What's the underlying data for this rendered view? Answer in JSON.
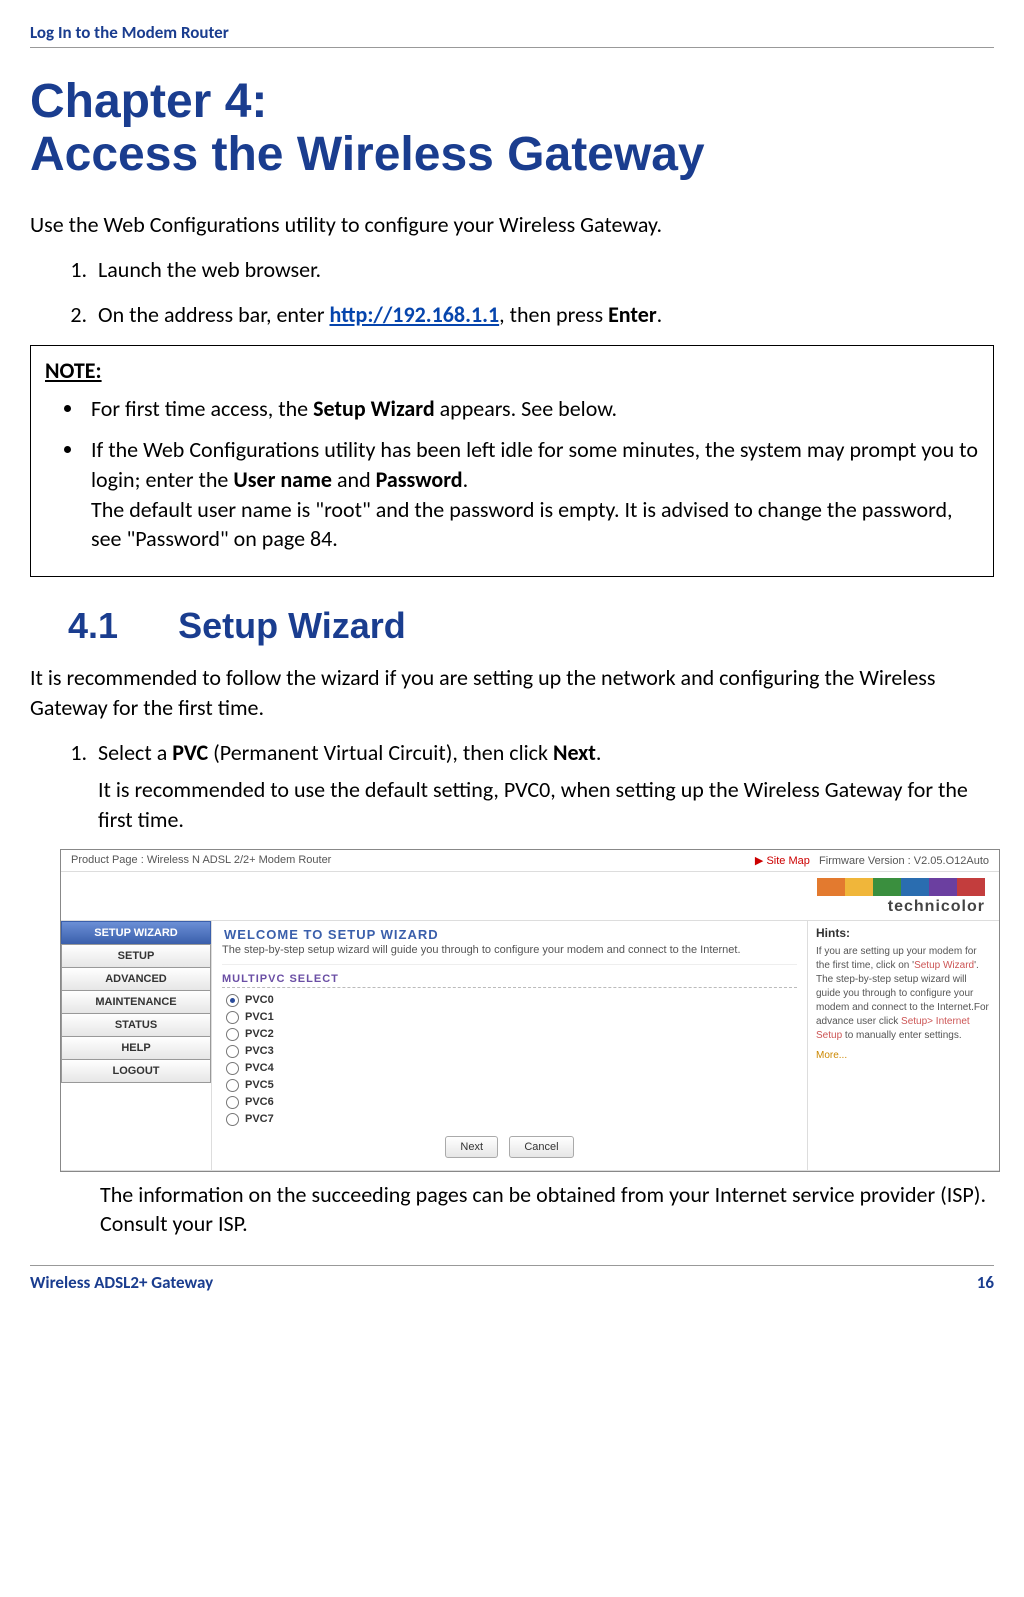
{
  "header": {
    "title": "Log In to the Modem Router"
  },
  "chapter": {
    "line1": "Chapter 4:",
    "line2": "Access the Wireless Gateway"
  },
  "intro": "Use the Web Configurations utility to configure your Wireless Gateway.",
  "steps_top": {
    "s1": "Launch the web browser.",
    "s2_a": "On the address bar, enter ",
    "s2_link": "http://192.168.1.1",
    "s2_b": ", then press ",
    "s2_bold": "Enter",
    "s2_c": "."
  },
  "note": {
    "label": "NOTE:",
    "b1_a": "For first time access, the ",
    "b1_bold": "Setup Wizard",
    "b1_b": " appears. See below.",
    "b2_a": "If the Web Configurations utility has been left idle for some minutes, the system may prompt you to login; enter the ",
    "b2_bold1": "User name",
    "b2_mid": " and ",
    "b2_bold2": "Password",
    "b2_b": ".",
    "b2_c": "The default user name is \"root\" and the password is empty. It is advised to change the password, see \"Password\" on page 84."
  },
  "section": {
    "num": "4.1",
    "title": "Setup Wizard"
  },
  "section_intro": "It is recommended to follow the wizard if you are setting up the network and configuring the Wireless Gateway for the first time.",
  "wizard_step": {
    "s1_a": "Select a ",
    "s1_bold1": "PVC",
    "s1_b": " (Permanent Virtual Circuit), then click ",
    "s1_bold2": "Next",
    "s1_c": ".",
    "sub": "It is recommended to use the default setting, PVC0, when setting up the Wireless Gateway for the first time."
  },
  "screenshot": {
    "product_page": "Product Page : Wireless N ADSL 2/2+ Modem Router",
    "site_map": "Site Map",
    "firmware": "Firmware Version :  V2.05.O12Auto",
    "logo": "technicolor",
    "colors": [
      "#e37a2f",
      "#f0b63a",
      "#3a8f3e",
      "#2a6db0",
      "#6b3fa0",
      "#c33d3d"
    ],
    "nav": [
      "SETUP WIZARD",
      "SETUP",
      "ADVANCED",
      "MAINTENANCE",
      "STATUS",
      "HELP",
      "LOGOUT"
    ],
    "welcome": "WELCOME TO SETUP WIZARD",
    "welcome_sub": "The step-by-step setup wizard will guide you through to configure your modem and connect to the Internet.",
    "multipvc": "MULTIPVC SELECT",
    "pvc": [
      "PVC0",
      "PVC1",
      "PVC2",
      "PVC3",
      "PVC4",
      "PVC5",
      "PVC6",
      "PVC7"
    ],
    "btn_next": "Next",
    "btn_cancel": "Cancel",
    "hints_title": "Hints:",
    "hints_body_a": "If you are setting up your modem for the first time, click on ",
    "hints_link1": "Setup Wizard",
    "hints_body_b": ". The step-by-step setup wizard will guide you through to configure your modem and connect to the Internet.For advance user click ",
    "hints_link2": "Setup> Internet Setup",
    "hints_body_c": " to manually enter settings.",
    "hints_more": "More..."
  },
  "after_shot": "The information on the succeeding pages can be obtained from your Internet service provider (ISP). Consult your ISP.",
  "footer": {
    "left": "Wireless ADSL2+ Gateway",
    "right": "16"
  }
}
